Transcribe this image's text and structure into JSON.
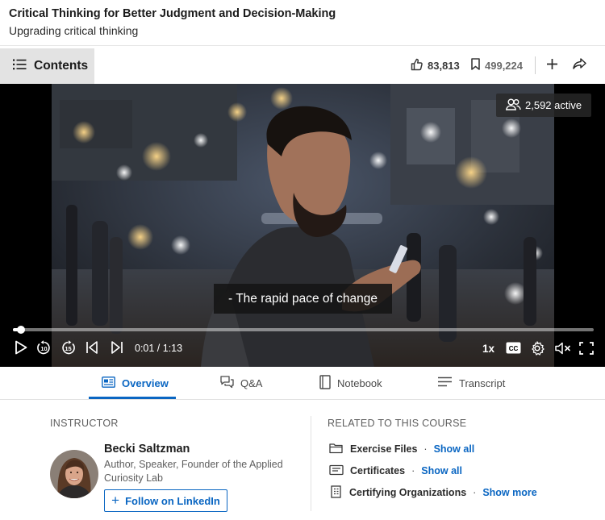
{
  "course": {
    "title": "Critical Thinking for Better Judgment and Decision-Making",
    "subtitle": "Upgrading critical thinking"
  },
  "toolbar": {
    "contents_label": "Contents",
    "likes": "83,813",
    "saves": "499,224",
    "icons": [
      "list-icon",
      "thumbs-up-icon",
      "bookmark-icon",
      "plus-icon",
      "share-icon"
    ]
  },
  "player": {
    "active_count": "2,592 active",
    "caption": "- The rapid pace of change",
    "time": "0:01 / 1:13",
    "progress_fraction": 0.014,
    "speed": "1x",
    "cc_label": "CC",
    "controls": [
      "play-icon",
      "rewind-10-icon",
      "forward-15-icon",
      "previous-icon",
      "next-icon",
      "settings-icon",
      "mute-icon",
      "fullscreen-icon"
    ]
  },
  "tabs": [
    {
      "label": "Overview",
      "icon": "overview-icon",
      "active": true
    },
    {
      "label": "Q&A",
      "icon": "qa-icon",
      "active": false
    },
    {
      "label": "Notebook",
      "icon": "notebook-icon",
      "active": false
    },
    {
      "label": "Transcript",
      "icon": "transcript-icon",
      "active": false
    }
  ],
  "instructor": {
    "heading": "INSTRUCTOR",
    "name": "Becki Saltzman",
    "title": "Author, Speaker, Founder of the Applied Curiosity Lab",
    "follow_label": "Follow on LinkedIn"
  },
  "related": {
    "heading": "RELATED TO THIS COURSE",
    "items": [
      {
        "label": "Exercise Files",
        "link": "Show all",
        "icon": "folder-icon"
      },
      {
        "label": "Certificates",
        "link": "Show all",
        "icon": "certificate-icon"
      },
      {
        "label": "Certifying Organizations",
        "link": "Show more",
        "icon": "organization-icon"
      }
    ]
  },
  "colors": {
    "accent": "#0a66c2",
    "contents_bg": "#e3e3e3"
  }
}
